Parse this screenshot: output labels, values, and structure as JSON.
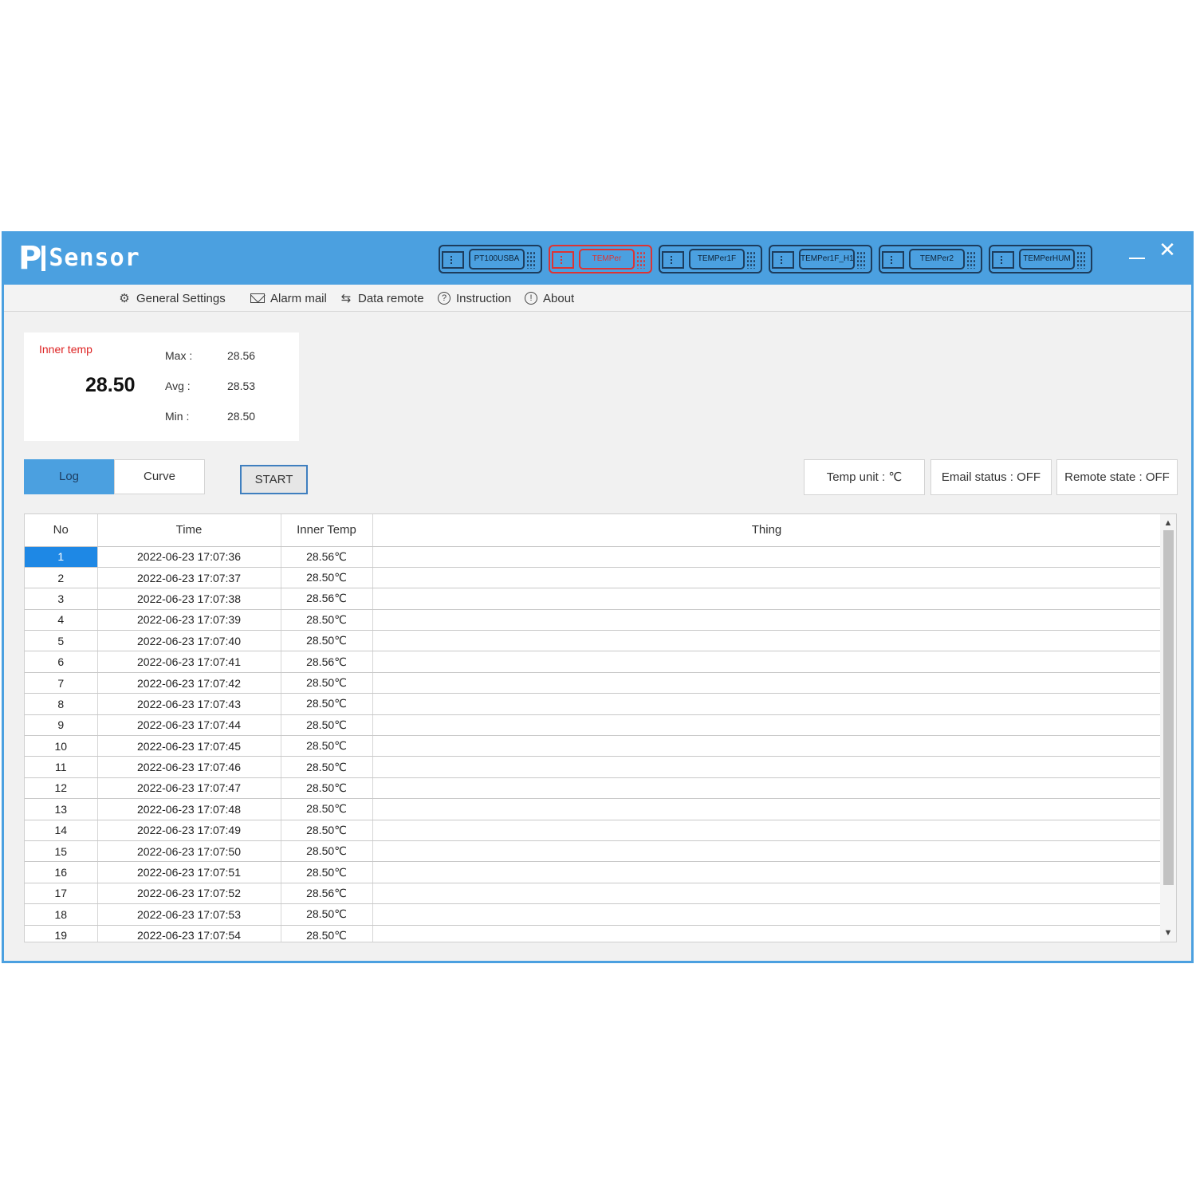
{
  "app": {
    "logo_p": "P",
    "logo_sensor": "Sensor"
  },
  "devices": [
    {
      "label": "PT100USBA",
      "active": false
    },
    {
      "label": "TEMPer",
      "active": true
    },
    {
      "label": "TEMPer1F",
      "active": false
    },
    {
      "label": "TEMPer1F_H1",
      "active": false
    },
    {
      "label": "TEMPer2",
      "active": false
    },
    {
      "label": "TEMPerHUM",
      "active": false
    }
  ],
  "window_controls": {
    "minimize": "—",
    "close": "✕"
  },
  "menu": {
    "general_settings": "General Settings",
    "alarm_mail": "Alarm mail",
    "data_remote": "Data remote",
    "instruction": "Instruction",
    "about": "About"
  },
  "stats": {
    "inner_label": "Inner temp",
    "current": "28.50",
    "max_label": "Max :",
    "max": "28.56",
    "avg_label": "Avg :",
    "avg": "28.53",
    "min_label": "Min :",
    "min": "28.50"
  },
  "tabs": {
    "log": "Log",
    "curve": "Curve"
  },
  "start_label": "START",
  "status": {
    "temp_unit": "Temp unit : ℃",
    "email_status": "Email status : OFF",
    "remote_state": "Remote state : OFF"
  },
  "table": {
    "headers": {
      "no": "No",
      "time": "Time",
      "inner_temp": "Inner Temp",
      "thing": "Thing"
    },
    "rows": [
      {
        "no": "1",
        "time": "2022-06-23 17:07:36",
        "temp": "28.56℃",
        "thing": ""
      },
      {
        "no": "2",
        "time": "2022-06-23 17:07:37",
        "temp": "28.50℃",
        "thing": ""
      },
      {
        "no": "3",
        "time": "2022-06-23 17:07:38",
        "temp": "28.56℃",
        "thing": ""
      },
      {
        "no": "4",
        "time": "2022-06-23 17:07:39",
        "temp": "28.50℃",
        "thing": ""
      },
      {
        "no": "5",
        "time": "2022-06-23 17:07:40",
        "temp": "28.50℃",
        "thing": ""
      },
      {
        "no": "6",
        "time": "2022-06-23 17:07:41",
        "temp": "28.56℃",
        "thing": ""
      },
      {
        "no": "7",
        "time": "2022-06-23 17:07:42",
        "temp": "28.50℃",
        "thing": ""
      },
      {
        "no": "8",
        "time": "2022-06-23 17:07:43",
        "temp": "28.50℃",
        "thing": ""
      },
      {
        "no": "9",
        "time": "2022-06-23 17:07:44",
        "temp": "28.50℃",
        "thing": ""
      },
      {
        "no": "10",
        "time": "2022-06-23 17:07:45",
        "temp": "28.50℃",
        "thing": ""
      },
      {
        "no": "11",
        "time": "2022-06-23 17:07:46",
        "temp": "28.50℃",
        "thing": ""
      },
      {
        "no": "12",
        "time": "2022-06-23 17:07:47",
        "temp": "28.50℃",
        "thing": ""
      },
      {
        "no": "13",
        "time": "2022-06-23 17:07:48",
        "temp": "28.50℃",
        "thing": ""
      },
      {
        "no": "14",
        "time": "2022-06-23 17:07:49",
        "temp": "28.50℃",
        "thing": ""
      },
      {
        "no": "15",
        "time": "2022-06-23 17:07:50",
        "temp": "28.50℃",
        "thing": ""
      },
      {
        "no": "16",
        "time": "2022-06-23 17:07:51",
        "temp": "28.50℃",
        "thing": ""
      },
      {
        "no": "17",
        "time": "2022-06-23 17:07:52",
        "temp": "28.56℃",
        "thing": ""
      },
      {
        "no": "18",
        "time": "2022-06-23 17:07:53",
        "temp": "28.50℃",
        "thing": ""
      },
      {
        "no": "19",
        "time": "2022-06-23 17:07:54",
        "temp": "28.50℃",
        "thing": ""
      }
    ],
    "selected_row": "1"
  },
  "colors": {
    "accent": "#4ba0e0",
    "selected": "#1e88e5",
    "inner_label": "#dd2222"
  }
}
